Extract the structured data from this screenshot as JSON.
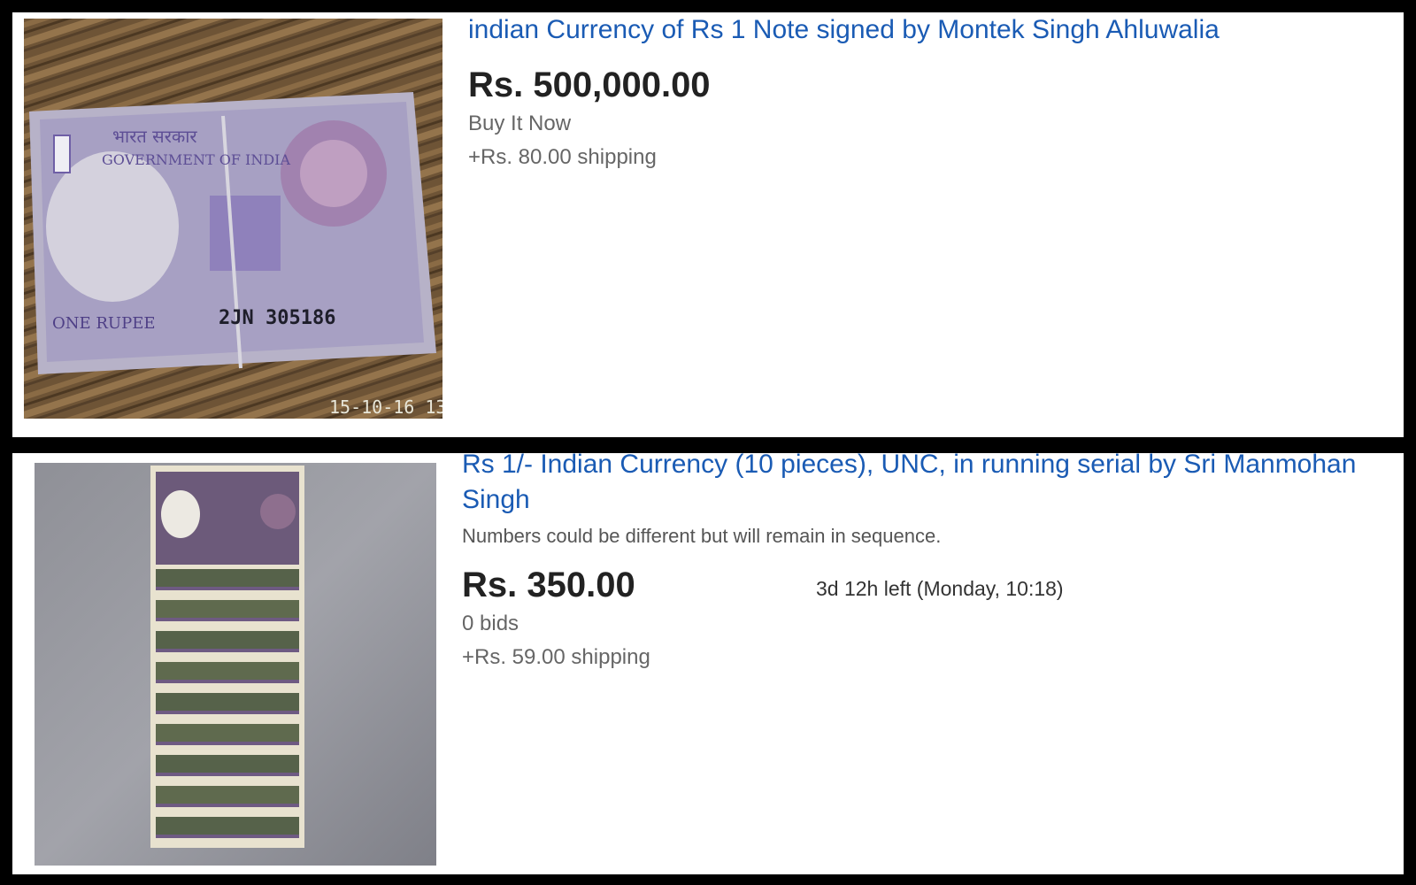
{
  "listings": [
    {
      "title": "indian Currency of Rs 1 Note signed by Montek Singh Ahluwalia",
      "price": "Rs. 500,000.00",
      "format": "Buy It Now",
      "shipping": "+Rs. 80.00 shipping",
      "image": {
        "photo_stamp": "15-10-16 13",
        "note_text": {
          "hindi": "भारत सरकार",
          "government": "GOVERNMENT OF INDIA",
          "denomination": "ONE RUPEE",
          "serial": "2JN  305186"
        }
      }
    },
    {
      "title": "Rs 1/- Indian Currency (10 pieces), UNC, in running serial by Sri Manmohan Singh",
      "subtitle": "Numbers could be different but will remain in sequence.",
      "price": "Rs. 350.00",
      "time_left": "3d 12h left (Monday, 10:18)",
      "bids": "0 bids",
      "shipping": "+Rs. 59.00 shipping"
    }
  ]
}
